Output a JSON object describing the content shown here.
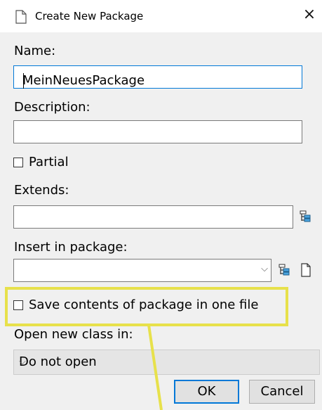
{
  "window": {
    "title": "Create New Package",
    "close_glyph": "×"
  },
  "form": {
    "name_label": "Name:",
    "name_value": "MeinNeuesPackage",
    "description_label": "Description:",
    "description_value": "",
    "partial_label": "Partial",
    "partial_checked": false,
    "extends_label": "Extends:",
    "extends_value": "",
    "insert_label": "Insert in package:",
    "insert_value": "",
    "save_one_file_label": "Save contents of package in one file",
    "save_one_file_checked": false,
    "open_new_class_label": "Open new class in:",
    "open_new_class_value": "Do not open"
  },
  "buttons": {
    "ok": "OK",
    "cancel": "Cancel"
  },
  "icons": {
    "title": "document-icon",
    "extends_browse": "class-tree-icon",
    "insert_browse": "class-tree-icon",
    "insert_new_file": "new-file-icon",
    "combo_chevron": "chevron-down-icon"
  },
  "colors": {
    "accent": "#0078d7",
    "highlight_annotation": "#e7e14b",
    "dialog_bg": "#f0f0f0"
  }
}
